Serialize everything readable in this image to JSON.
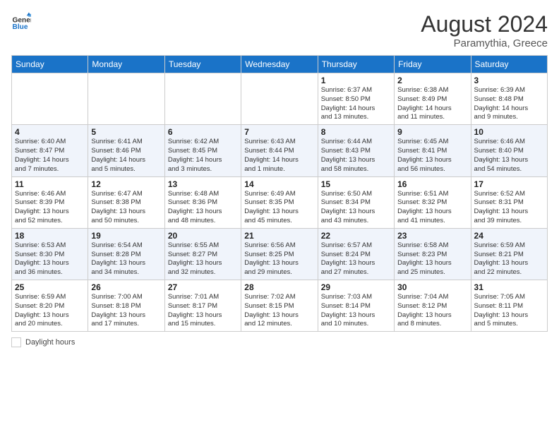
{
  "header": {
    "logo_general": "General",
    "logo_blue": "Blue",
    "month_year": "August 2024",
    "location": "Paramythia, Greece"
  },
  "calendar": {
    "days_of_week": [
      "Sunday",
      "Monday",
      "Tuesday",
      "Wednesday",
      "Thursday",
      "Friday",
      "Saturday"
    ],
    "weeks": [
      [
        {
          "day": "",
          "info": ""
        },
        {
          "day": "",
          "info": ""
        },
        {
          "day": "",
          "info": ""
        },
        {
          "day": "",
          "info": ""
        },
        {
          "day": "1",
          "info": "Sunrise: 6:37 AM\nSunset: 8:50 PM\nDaylight: 14 hours\nand 13 minutes."
        },
        {
          "day": "2",
          "info": "Sunrise: 6:38 AM\nSunset: 8:49 PM\nDaylight: 14 hours\nand 11 minutes."
        },
        {
          "day": "3",
          "info": "Sunrise: 6:39 AM\nSunset: 8:48 PM\nDaylight: 14 hours\nand 9 minutes."
        }
      ],
      [
        {
          "day": "4",
          "info": "Sunrise: 6:40 AM\nSunset: 8:47 PM\nDaylight: 14 hours\nand 7 minutes."
        },
        {
          "day": "5",
          "info": "Sunrise: 6:41 AM\nSunset: 8:46 PM\nDaylight: 14 hours\nand 5 minutes."
        },
        {
          "day": "6",
          "info": "Sunrise: 6:42 AM\nSunset: 8:45 PM\nDaylight: 14 hours\nand 3 minutes."
        },
        {
          "day": "7",
          "info": "Sunrise: 6:43 AM\nSunset: 8:44 PM\nDaylight: 14 hours\nand 1 minute."
        },
        {
          "day": "8",
          "info": "Sunrise: 6:44 AM\nSunset: 8:43 PM\nDaylight: 13 hours\nand 58 minutes."
        },
        {
          "day": "9",
          "info": "Sunrise: 6:45 AM\nSunset: 8:41 PM\nDaylight: 13 hours\nand 56 minutes."
        },
        {
          "day": "10",
          "info": "Sunrise: 6:46 AM\nSunset: 8:40 PM\nDaylight: 13 hours\nand 54 minutes."
        }
      ],
      [
        {
          "day": "11",
          "info": "Sunrise: 6:46 AM\nSunset: 8:39 PM\nDaylight: 13 hours\nand 52 minutes."
        },
        {
          "day": "12",
          "info": "Sunrise: 6:47 AM\nSunset: 8:38 PM\nDaylight: 13 hours\nand 50 minutes."
        },
        {
          "day": "13",
          "info": "Sunrise: 6:48 AM\nSunset: 8:36 PM\nDaylight: 13 hours\nand 48 minutes."
        },
        {
          "day": "14",
          "info": "Sunrise: 6:49 AM\nSunset: 8:35 PM\nDaylight: 13 hours\nand 45 minutes."
        },
        {
          "day": "15",
          "info": "Sunrise: 6:50 AM\nSunset: 8:34 PM\nDaylight: 13 hours\nand 43 minutes."
        },
        {
          "day": "16",
          "info": "Sunrise: 6:51 AM\nSunset: 8:32 PM\nDaylight: 13 hours\nand 41 minutes."
        },
        {
          "day": "17",
          "info": "Sunrise: 6:52 AM\nSunset: 8:31 PM\nDaylight: 13 hours\nand 39 minutes."
        }
      ],
      [
        {
          "day": "18",
          "info": "Sunrise: 6:53 AM\nSunset: 8:30 PM\nDaylight: 13 hours\nand 36 minutes."
        },
        {
          "day": "19",
          "info": "Sunrise: 6:54 AM\nSunset: 8:28 PM\nDaylight: 13 hours\nand 34 minutes."
        },
        {
          "day": "20",
          "info": "Sunrise: 6:55 AM\nSunset: 8:27 PM\nDaylight: 13 hours\nand 32 minutes."
        },
        {
          "day": "21",
          "info": "Sunrise: 6:56 AM\nSunset: 8:25 PM\nDaylight: 13 hours\nand 29 minutes."
        },
        {
          "day": "22",
          "info": "Sunrise: 6:57 AM\nSunset: 8:24 PM\nDaylight: 13 hours\nand 27 minutes."
        },
        {
          "day": "23",
          "info": "Sunrise: 6:58 AM\nSunset: 8:23 PM\nDaylight: 13 hours\nand 25 minutes."
        },
        {
          "day": "24",
          "info": "Sunrise: 6:59 AM\nSunset: 8:21 PM\nDaylight: 13 hours\nand 22 minutes."
        }
      ],
      [
        {
          "day": "25",
          "info": "Sunrise: 6:59 AM\nSunset: 8:20 PM\nDaylight: 13 hours\nand 20 minutes."
        },
        {
          "day": "26",
          "info": "Sunrise: 7:00 AM\nSunset: 8:18 PM\nDaylight: 13 hours\nand 17 minutes."
        },
        {
          "day": "27",
          "info": "Sunrise: 7:01 AM\nSunset: 8:17 PM\nDaylight: 13 hours\nand 15 minutes."
        },
        {
          "day": "28",
          "info": "Sunrise: 7:02 AM\nSunset: 8:15 PM\nDaylight: 13 hours\nand 12 minutes."
        },
        {
          "day": "29",
          "info": "Sunrise: 7:03 AM\nSunset: 8:14 PM\nDaylight: 13 hours\nand 10 minutes."
        },
        {
          "day": "30",
          "info": "Sunrise: 7:04 AM\nSunset: 8:12 PM\nDaylight: 13 hours\nand 8 minutes."
        },
        {
          "day": "31",
          "info": "Sunrise: 7:05 AM\nSunset: 8:11 PM\nDaylight: 13 hours\nand 5 minutes."
        }
      ]
    ]
  },
  "legend": {
    "label": "Daylight hours"
  },
  "colors": {
    "header_bg": "#1a73c8",
    "row_even_bg": "#f0f4fb",
    "row_odd_bg": "#ffffff"
  }
}
